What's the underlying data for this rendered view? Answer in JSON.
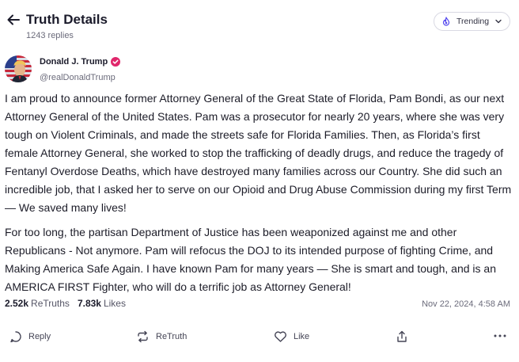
{
  "header": {
    "title": "Truth Details",
    "replies": "1243 replies",
    "trending_label": "Trending"
  },
  "post": {
    "author_name": "Donald J. Trump",
    "handle": "@realDonaldTrump",
    "paragraphs": [
      "I am proud to announce former Attorney General of the Great State of Florida, Pam Bondi, as our next Attorney General of the United States. Pam was a prosecutor for nearly 20 years, where she was very tough on Violent Criminals, and made the streets safe for Florida Families. Then, as Florida’s first female Attorney General, she worked to stop the trafficking of deadly drugs, and reduce the tragedy of Fentanyl Overdose Deaths, which have destroyed many families across our Country. She did such an incredible job, that I asked her to serve on our Opioid and Drug Abuse Commission during my first Term — We saved many lives!",
      "For too long, the partisan Department of Justice has been weaponized against me and other Republicans - Not anymore. Pam will refocus the DOJ to its intended purpose of fighting Crime, and Making America Safe Again. I have known Pam for many years — She is smart and tough, and is an AMERICA FIRST Fighter, who will do a terrific job as Attorney General!"
    ],
    "retruths_count": "2.52k",
    "retruths_label": "ReTruths",
    "likes_count": "7.83k",
    "likes_label": "Likes",
    "timestamp": "Nov 22, 2024, 4:58 AM"
  },
  "actions": {
    "reply": "Reply",
    "retruth": "ReTruth",
    "like": "Like"
  },
  "colors": {
    "accent": "#5448ee",
    "verified": "#e0266b",
    "text": "#1c1c28",
    "muted": "#6b6b7b"
  }
}
